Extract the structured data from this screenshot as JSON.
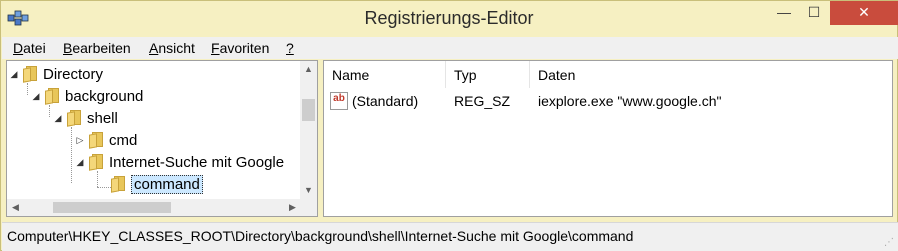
{
  "window": {
    "title": "Registrierungs-Editor",
    "minimize_glyph": "—",
    "maximize_glyph": "☐",
    "close_glyph": "✕",
    "accent_color": "#f6f0c2",
    "close_color": "#c94c3d"
  },
  "menu": [
    {
      "mnemonic": "D",
      "rest": "atei"
    },
    {
      "mnemonic": "B",
      "rest": "earbeiten"
    },
    {
      "mnemonic": "A",
      "rest": "nsicht"
    },
    {
      "mnemonic": "F",
      "rest": "avoriten"
    },
    {
      "mnemonic": "?",
      "rest": ""
    }
  ],
  "tree": [
    {
      "label": "Directory",
      "expander": "◢",
      "icon": "folder-icon"
    },
    {
      "label": "background",
      "expander": "◢",
      "icon": "folder-icon"
    },
    {
      "label": "shell",
      "expander": "◢",
      "icon": "folder-icon"
    },
    {
      "label": "cmd",
      "expander": "▷",
      "icon": "folder-icon"
    },
    {
      "label": "Internet-Suche mit Google",
      "expander": "◢",
      "icon": "folder-icon"
    },
    {
      "label": "command",
      "expander": "",
      "icon": "folder-icon",
      "selected": true
    }
  ],
  "list": {
    "columns": [
      "Name",
      "Typ",
      "Daten"
    ],
    "rows": [
      {
        "name": "(Standard)",
        "type": "REG_SZ",
        "data": "iexplore.exe \"www.google.ch\"",
        "icon": "ab"
      }
    ]
  },
  "status": {
    "path": "Computer\\HKEY_CLASSES_ROOT\\Directory\\background\\shell\\Internet-Suche mit Google\\command"
  },
  "scroll": {
    "up": "▲",
    "down": "▼",
    "left": "◀",
    "right": "▶"
  }
}
